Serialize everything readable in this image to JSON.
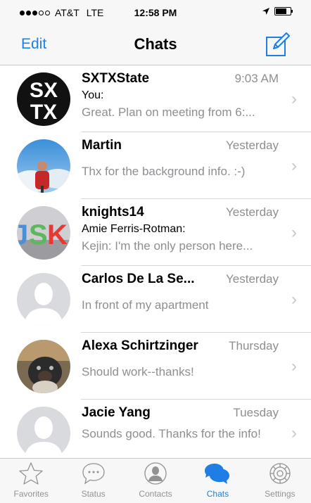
{
  "status_bar": {
    "signal_dots_filled": 3,
    "signal_dots_total": 5,
    "carrier": "AT&T",
    "network": "LTE",
    "time": "12:58 PM",
    "location_icon": "location-arrow-icon",
    "battery_icon": "battery-icon"
  },
  "nav": {
    "edit_label": "Edit",
    "title": "Chats",
    "compose_icon": "compose-icon"
  },
  "chats": [
    {
      "name": "SXTXState",
      "time": "9:03 AM",
      "sender": "You:",
      "preview": "Great. Plan on meeting from 6:...",
      "avatar": "sxtx-logo"
    },
    {
      "name": "Martin",
      "time": "Yesterday",
      "sender": "",
      "preview": "Thx for the background info. :-)",
      "avatar": "photo-person-sky"
    },
    {
      "name": "knights14",
      "time": "Yesterday",
      "sender": "Amie Ferris-Rotman:",
      "preview": "Kejin: I'm the only person here...",
      "avatar": "photo-jsk-letters"
    },
    {
      "name": "Carlos  De La Se...",
      "time": "Yesterday",
      "sender": "",
      "preview": "In front of my apartment",
      "avatar": "default-silhouette"
    },
    {
      "name": "Alexa Schirtzinger",
      "time": "Thursday",
      "sender": "",
      "preview": "Should work--thanks!",
      "avatar": "photo-dog"
    },
    {
      "name": "Jacie Yang",
      "time": "Tuesday",
      "sender": "",
      "preview": "Sounds good. Thanks for the info!",
      "avatar": "default-silhouette"
    }
  ],
  "tabs": [
    {
      "label": "Favorites",
      "icon": "star-icon",
      "active": false
    },
    {
      "label": "Status",
      "icon": "speech-bubble-dots-icon",
      "active": false
    },
    {
      "label": "Contacts",
      "icon": "contact-circle-icon",
      "active": false
    },
    {
      "label": "Chats",
      "icon": "chat-bubbles-icon",
      "active": true
    },
    {
      "label": "Settings",
      "icon": "gear-icon",
      "active": false
    }
  ],
  "colors": {
    "accent": "#1f7ee6",
    "secondary_text": "#8e8e93",
    "tab_inactive": "#929292",
    "bar_background": "#f7f7f8"
  }
}
